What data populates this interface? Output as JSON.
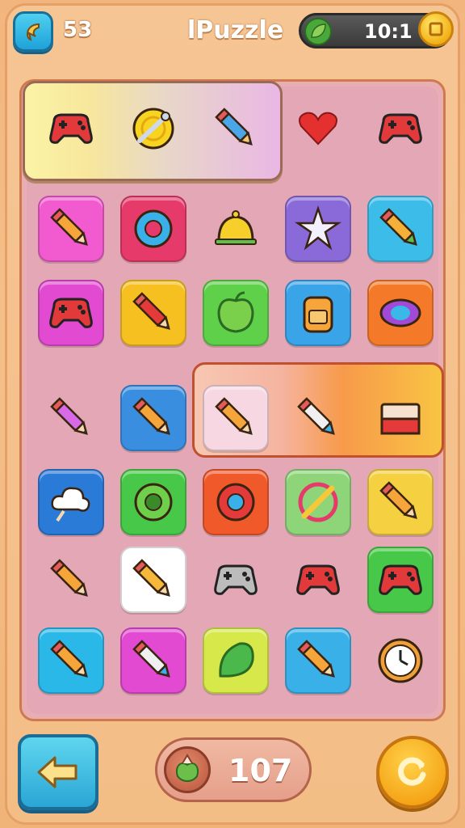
{
  "header": {
    "level": "53",
    "title": "lPuzzle",
    "score": "10:1",
    "back_icon": "back-arrow-icon",
    "leaf_icon": "leaf-icon",
    "coin_icon": "coin-icon"
  },
  "footer": {
    "counter": "107",
    "back_icon": "left-arrow-icon",
    "refresh_icon": "refresh-icon"
  },
  "colors": {
    "background": "#f3bd86",
    "board": "#e3a7b6",
    "accent_blue": "#2aa6d6",
    "accent_orange": "#f5a316"
  },
  "grid": {
    "rows": 7,
    "cols": 5,
    "items": [
      "gamepad",
      "lollipop",
      "pencil-splash",
      "heart",
      "gamepad",
      "pencil",
      "donut",
      "bell",
      "star-wand",
      "bandage-pencil",
      "gamepad",
      "pen",
      "apple",
      "backpack",
      "eye",
      "leaf-pencil",
      "pencil",
      "pencil",
      "marker",
      "eraser-box",
      "cloud",
      "blob",
      "ball",
      "crossed-pencil",
      "pencil",
      "pencil",
      "crayon",
      "gamepad-stick",
      "gamepad",
      "gamepad",
      "pencil",
      "marker",
      "leaf",
      "brush",
      "clock"
    ]
  }
}
